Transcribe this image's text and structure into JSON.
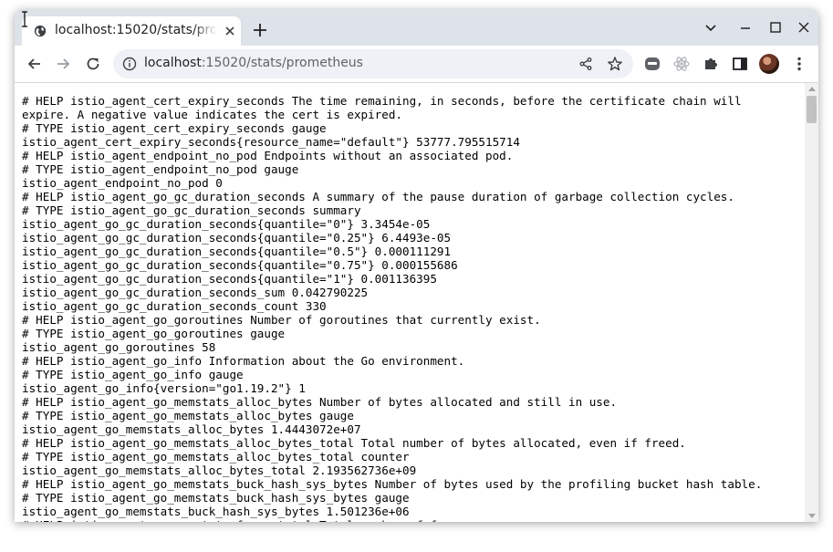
{
  "browser": {
    "tab": {
      "title": "localhost:15020/stats/prometheus",
      "favicon": "globe-icon"
    },
    "address_bar": {
      "host": "localhost",
      "path": ":15020/stats/prometheus"
    },
    "colors": {
      "tabstrip": "#dee3ea",
      "omnibox": "#eef1f6"
    }
  },
  "content": {
    "lines": [
      "# HELP istio_agent_cert_expiry_seconds The time remaining, in seconds, before the certificate chain will",
      "expire. A negative value indicates the cert is expired.",
      "# TYPE istio_agent_cert_expiry_seconds gauge",
      "istio_agent_cert_expiry_seconds{resource_name=\"default\"} 53777.795515714",
      "# HELP istio_agent_endpoint_no_pod Endpoints without an associated pod.",
      "# TYPE istio_agent_endpoint_no_pod gauge",
      "istio_agent_endpoint_no_pod 0",
      "# HELP istio_agent_go_gc_duration_seconds A summary of the pause duration of garbage collection cycles.",
      "# TYPE istio_agent_go_gc_duration_seconds summary",
      "istio_agent_go_gc_duration_seconds{quantile=\"0\"} 3.3454e-05",
      "istio_agent_go_gc_duration_seconds{quantile=\"0.25\"} 6.4493e-05",
      "istio_agent_go_gc_duration_seconds{quantile=\"0.5\"} 0.000111291",
      "istio_agent_go_gc_duration_seconds{quantile=\"0.75\"} 0.000155686",
      "istio_agent_go_gc_duration_seconds{quantile=\"1\"} 0.001136395",
      "istio_agent_go_gc_duration_seconds_sum 0.042790225",
      "istio_agent_go_gc_duration_seconds_count 330",
      "# HELP istio_agent_go_goroutines Number of goroutines that currently exist.",
      "# TYPE istio_agent_go_goroutines gauge",
      "istio_agent_go_goroutines 58",
      "# HELP istio_agent_go_info Information about the Go environment.",
      "# TYPE istio_agent_go_info gauge",
      "istio_agent_go_info{version=\"go1.19.2\"} 1",
      "# HELP istio_agent_go_memstats_alloc_bytes Number of bytes allocated and still in use.",
      "# TYPE istio_agent_go_memstats_alloc_bytes gauge",
      "istio_agent_go_memstats_alloc_bytes 1.4443072e+07",
      "# HELP istio_agent_go_memstats_alloc_bytes_total Total number of bytes allocated, even if freed.",
      "# TYPE istio_agent_go_memstats_alloc_bytes_total counter",
      "istio_agent_go_memstats_alloc_bytes_total 2.193562736e+09",
      "# HELP istio_agent_go_memstats_buck_hash_sys_bytes Number of bytes used by the profiling bucket hash table.",
      "# TYPE istio_agent_go_memstats_buck_hash_sys_bytes gauge",
      "istio_agent_go_memstats_buck_hash_sys_bytes 1.501236e+06",
      "# HELP istio_agent_go_memstats_frees_total Total number of frees."
    ]
  }
}
